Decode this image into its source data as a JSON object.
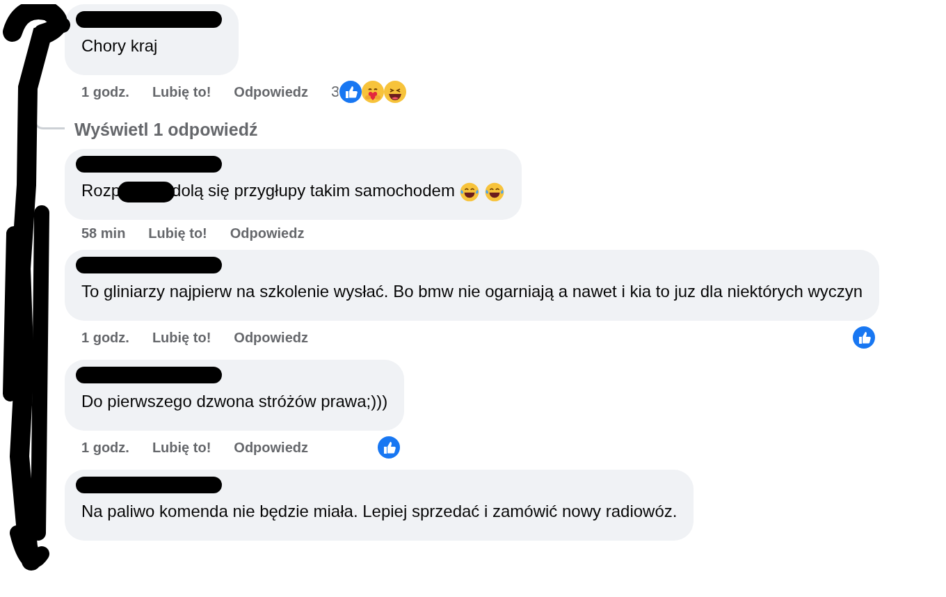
{
  "comments": [
    {
      "text_parts": [
        "Chory kraj"
      ],
      "time": "1 godz.",
      "like": "Lubię to!",
      "reply": "Odpowiedz",
      "reaction_count": "3",
      "reactions": [
        {
          "kind": "like"
        },
        {
          "kind": "care"
        },
        {
          "kind": "haha"
        }
      ],
      "replies_link": "Wyświetl 1 odpowiedź"
    },
    {
      "text_parts": [
        "Rozp",
        "dolą się przygłupy takim samochodem"
      ],
      "emojis": [
        {
          "kind": "laugh_cry"
        },
        {
          "kind": "laugh_cry"
        }
      ],
      "time": "58 min",
      "like": "Lubię to!",
      "reply": "Odpowiedz"
    },
    {
      "text_parts": [
        "To gliniarzy najpierw na szkolenie wysłać. Bo bmw nie ogarniają a nawet i kia to juz dla niektórych wyczyn"
      ],
      "time": "1 godz.",
      "like": "Lubię to!",
      "reply": "Odpowiedz",
      "reactions": [
        {
          "kind": "like"
        }
      ]
    },
    {
      "text_parts": [
        "Do pierwszego dzwona stróżów prawa;)))"
      ],
      "time": "1 godz.",
      "like": "Lubię to!",
      "reply": "Odpowiedz",
      "reactions": [
        {
          "kind": "like"
        }
      ]
    },
    {
      "text_parts": [
        "Na paliwo komenda nie będzie miała. Lepiej sprzedać i zamówić nowy radiowóz."
      ]
    }
  ]
}
